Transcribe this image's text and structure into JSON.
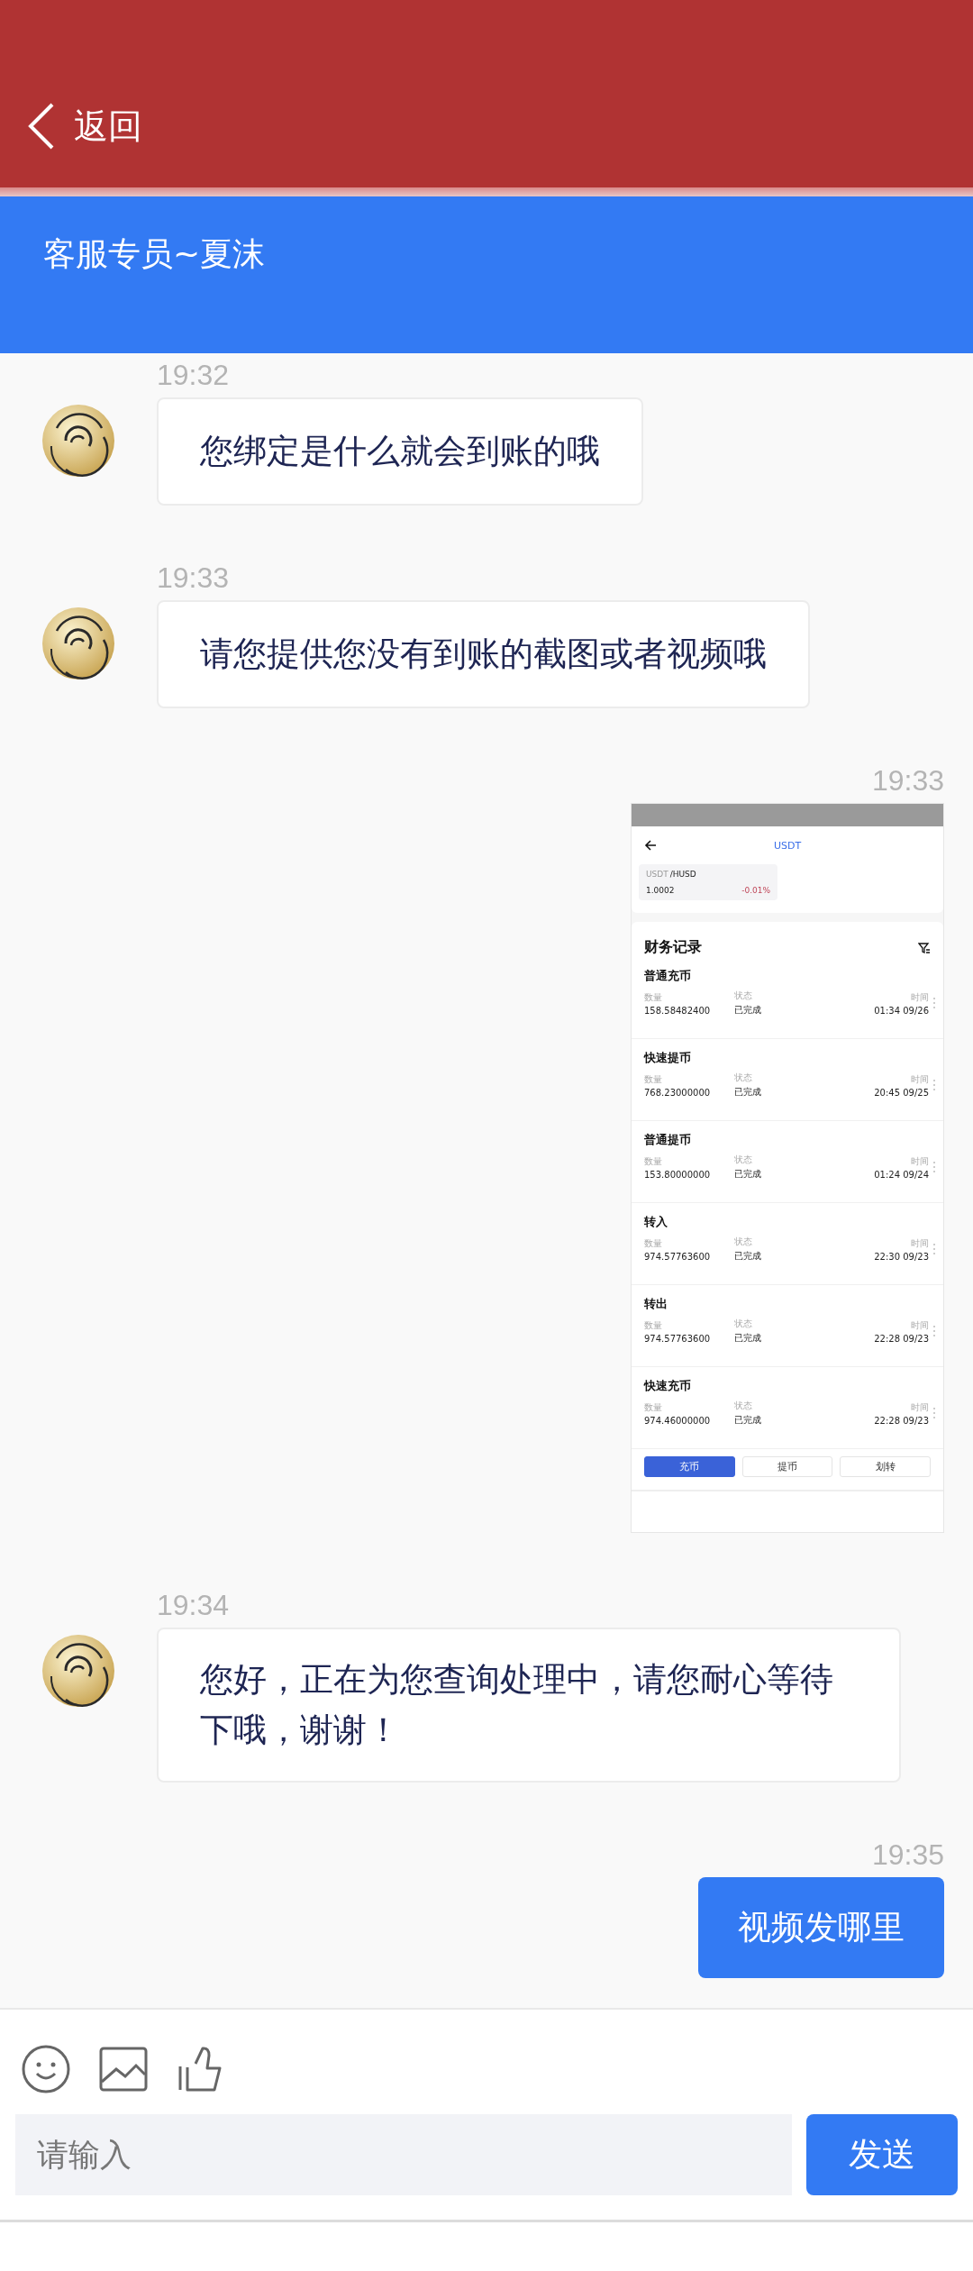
{
  "header": {
    "back_label": "返回"
  },
  "chat": {
    "title": "客服专员~夏沫"
  },
  "messages": [
    {
      "kind": "text",
      "outgoing": false,
      "time": "19:32",
      "text": "您绑定是什么就会到账的哦"
    },
    {
      "kind": "text",
      "outgoing": false,
      "time": "19:33",
      "text": "请您提供您没有到账的截图或者视频哦"
    },
    {
      "kind": "image",
      "outgoing": true,
      "time": "19:33",
      "screenshot": {
        "title": "USDT",
        "pair": {
          "base": "USDT",
          "quote": "/HUSD",
          "price": "1.0002",
          "change": "-0.01%"
        },
        "section_title": "财务记录",
        "records": [
          {
            "title": "普通充币",
            "fields": [
              {
                "label": "数量",
                "value": "158.58482400"
              },
              {
                "label": "状态",
                "value": "已完成"
              },
              {
                "label": "时间",
                "value": "01:34 09/26"
              }
            ]
          },
          {
            "title": "快速提币",
            "fields": [
              {
                "label": "数量",
                "value": "768.23000000"
              },
              {
                "label": "状态",
                "value": "已完成"
              },
              {
                "label": "时间",
                "value": "20:45 09/25"
              }
            ]
          },
          {
            "title": "普通提币",
            "fields": [
              {
                "label": "数量",
                "value": "153.80000000"
              },
              {
                "label": "状态",
                "value": "已完成"
              },
              {
                "label": "时间",
                "value": "01:24 09/24"
              }
            ]
          },
          {
            "title": "转入",
            "fields": [
              {
                "label": "数量",
                "value": "974.57763600"
              },
              {
                "label": "状态",
                "value": "已完成"
              },
              {
                "label": "时间",
                "value": "22:30 09/23"
              }
            ]
          },
          {
            "title": "转出",
            "fields": [
              {
                "label": "数量",
                "value": "974.57763600"
              },
              {
                "label": "状态",
                "value": "已完成"
              },
              {
                "label": "时间",
                "value": "22:28 09/23"
              }
            ]
          },
          {
            "title": "快速充币",
            "fields": [
              {
                "label": "数量",
                "value": "974.46000000"
              },
              {
                "label": "状态",
                "value": "已完成"
              },
              {
                "label": "时间",
                "value": "22:28 09/23"
              }
            ]
          }
        ],
        "buttons": [
          {
            "label": "充币",
            "selected": true
          },
          {
            "label": "提币",
            "selected": false
          },
          {
            "label": "划转",
            "selected": false
          }
        ]
      }
    },
    {
      "kind": "text",
      "outgoing": false,
      "time": "19:34",
      "text": "您好，正在为您查询处理中，请您耐心等待下哦，谢谢！"
    },
    {
      "kind": "text",
      "outgoing": true,
      "time": "19:35",
      "text": "视频发哪里"
    }
  ],
  "composer": {
    "placeholder": "请输入",
    "send_label": "发送"
  }
}
